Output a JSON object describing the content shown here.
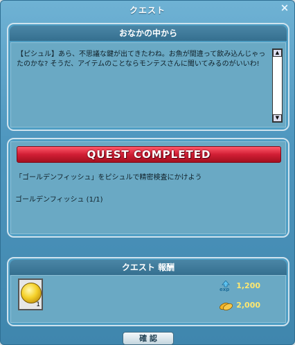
{
  "window": {
    "title": "クエスト",
    "close_symbol": "×"
  },
  "description": {
    "title": "おなかの中から",
    "text": "【ピシュル】あら、不思議な鍵が出てきたわね。お魚が間違って飲み込んじゃったのかな? そうだ、アイテムのことならモンテスさんに聞いてみるのがいいわ!"
  },
  "progress": {
    "banner": "QUEST COMPLETED",
    "objective": "「ゴールデンフィッシュ」をピシュルで精密検査にかけよう",
    "item_progress": "ゴールデンフィッシュ (1/1)"
  },
  "reward": {
    "title": "クエスト 報酬",
    "item_count": "1",
    "exp_label": "exp",
    "exp": "1,200",
    "meso": "2,000"
  },
  "buttons": {
    "confirm": "確 認"
  },
  "colors": {
    "accent": "#4f97bf",
    "banner": "#d11e35",
    "reward_text": "#ffe870"
  }
}
